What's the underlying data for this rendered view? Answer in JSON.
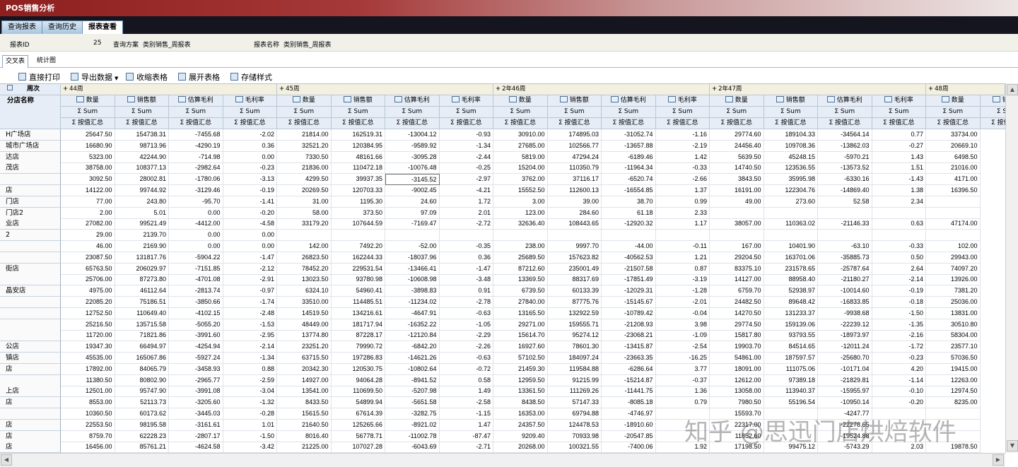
{
  "app": {
    "title": "POS销售分析"
  },
  "tabs": [
    "查询报表",
    "查询历史",
    "报表查看"
  ],
  "info": {
    "id_label": "报表ID",
    "id_value": "25",
    "plan_label": "查询方案",
    "plan_value": "类别销售_周报表",
    "name_label": "报表名称",
    "name_value": "类别销售_周报表"
  },
  "view_tabs": [
    "交叉表",
    "统计图"
  ],
  "toolbar": {
    "print": "直接打印",
    "export": "导出数据",
    "collapse": "收缩表格",
    "expand": "展开表格",
    "save_style": "存储样式"
  },
  "grid": {
    "week_label": "周次",
    "store_label": "分店名称",
    "weeks": [
      "44周",
      "45周",
      "2年46周",
      "2年47周",
      "48周"
    ],
    "measures": [
      "数量",
      "销售额",
      "估算毛利",
      "毛利率"
    ],
    "sum_label": "Sum",
    "agg_label": "按值汇总",
    "stores": [
      "H广场店",
      "城市广场店",
      "达店",
      "茂店",
      "",
      "店",
      "门店",
      "门店2",
      "业店",
      "2",
      "",
      "",
      "街店",
      "",
      "晶安店",
      "",
      "",
      "",
      "",
      "公店",
      "镇店",
      "店",
      "",
      "上店",
      "店",
      "",
      "店",
      "店",
      "店",
      ""
    ],
    "rows": [
      [
        "25647.50",
        "154738.31",
        "-7455.68",
        "-2.02",
        "21814.00",
        "162519.31",
        "-13004.12",
        "-0.93",
        "30910.00",
        "174895.03",
        "-31052.74",
        "-1.16",
        "29774.60",
        "189104.33",
        "-34564.14",
        "0.77",
        "33734.00"
      ],
      [
        "16680.90",
        "98713.96",
        "-4290.19",
        "0.36",
        "32521.20",
        "120384.95",
        "-9589.92",
        "-1.34",
        "27685.00",
        "102566.77",
        "-13657.88",
        "-2.19",
        "24456.40",
        "109708.36",
        "-13862.03",
        "-0.27",
        "20669.10"
      ],
      [
        "5323.00",
        "42244.90",
        "-714.98",
        "0.00",
        "7330.50",
        "48161.66",
        "-3095.28",
        "-2.44",
        "5819.00",
        "47294.24",
        "-6189.46",
        "1.42",
        "5639.50",
        "45248.15",
        "-5970.21",
        "1.43",
        "6498.50"
      ],
      [
        "38758.00",
        "108377.13",
        "-2982.64",
        "-0.23",
        "21836.00",
        "110472.18",
        "-10076.48",
        "-0.25",
        "15204.00",
        "110350.79",
        "-11964.34",
        "-0.33",
        "14740.50",
        "123536.55",
        "-13573.52",
        "1.51",
        "21016.00"
      ],
      [
        "3092.50",
        "28002.81",
        "-1780.06",
        "-3.13",
        "4299.50",
        "39937.35",
        "-3145.52",
        "-2.97",
        "3762.00",
        "37116.17",
        "-6520.74",
        "-2.66",
        "3843.50",
        "35995.98",
        "-6330.16",
        "-1.43",
        "4171.00"
      ],
      [
        "14122.00",
        "99744.92",
        "-3129.46",
        "-0.19",
        "20269.50",
        "120703.33",
        "-9002.45",
        "-4.21",
        "15552.50",
        "112600.13",
        "-16554.85",
        "1.37",
        "16191.00",
        "122304.76",
        "-14869.40",
        "1.38",
        "16396.50"
      ],
      [
        "77.00",
        "243.80",
        "-95.70",
        "-1.41",
        "31.00",
        "1195.30",
        "24.60",
        "1.72",
        "3.00",
        "39.00",
        "38.70",
        "0.99",
        "49.00",
        "273.60",
        "52.58",
        "2.34",
        ""
      ],
      [
        "2.00",
        "5.01",
        "0.00",
        "-0.20",
        "58.00",
        "373.50",
        "97.09",
        "2.01",
        "123.00",
        "284.60",
        "61.18",
        "2.33",
        "",
        "",
        "",
        "",
        ""
      ],
      [
        "27082.00",
        "99521.49",
        "-4412.00",
        "-4.58",
        "33179.20",
        "107644.59",
        "-7169.47",
        "-2.72",
        "32636.40",
        "108443.65",
        "-12920.32",
        "1.17",
        "38057.00",
        "110363.02",
        "-21146.33",
        "0.63",
        "47174.00"
      ],
      [
        "29.00",
        "2139.70",
        "0.00",
        "0.00",
        "",
        "",
        "",
        "",
        "",
        "",
        "",
        "",
        "",
        "",
        "",
        "",
        ""
      ],
      [
        "46.00",
        "2169.90",
        "0.00",
        "0.00",
        "142.00",
        "7492.20",
        "-52.00",
        "-0.35",
        "238.00",
        "9997.70",
        "-44.00",
        "-0.11",
        "167.00",
        "10401.90",
        "-63.10",
        "-0.33",
        "102.00"
      ],
      [
        "23087.50",
        "131817.76",
        "-5904.22",
        "-1.47",
        "26823.50",
        "162244.33",
        "-18037.96",
        "0.36",
        "25689.50",
        "157623.82",
        "-40562.53",
        "1.21",
        "29204.50",
        "163701.06",
        "-35885.73",
        "0.50",
        "29943.00"
      ],
      [
        "65763.50",
        "206029.97",
        "-7151.85",
        "-2.12",
        "78452.20",
        "229531.54",
        "-13466.41",
        "-1.47",
        "87212.60",
        "235001.49",
        "-21507.58",
        "0.87",
        "83375.10",
        "231578.65",
        "-25787.64",
        "2.64",
        "74097.20"
      ],
      [
        "25706.00",
        "87273.80",
        "-4701.08",
        "-2.91",
        "13023.50",
        "93780.98",
        "-10608.98",
        "-3.48",
        "13369.50",
        "88317.69",
        "-17851.49",
        "-3.19",
        "14127.00",
        "88958.40",
        "-21180.27",
        "-2.14",
        "13926.00"
      ],
      [
        "4975.00",
        "46112.64",
        "-2813.74",
        "-0.97",
        "6324.10",
        "54960.41",
        "-3898.83",
        "0.91",
        "6739.50",
        "60133.39",
        "-12029.31",
        "-1.28",
        "6759.70",
        "52938.97",
        "-10014.60",
        "-0.19",
        "7381.20"
      ],
      [
        "22085.20",
        "75186.51",
        "-3850.66",
        "-1.74",
        "33510.00",
        "114485.51",
        "-11234.02",
        "-2.78",
        "27840.00",
        "87775.76",
        "-15145.67",
        "-2.01",
        "24482.50",
        "89648.42",
        "-16833.85",
        "-0.18",
        "25036.00"
      ],
      [
        "12752.50",
        "110649.40",
        "-4102.15",
        "-2.48",
        "14519.50",
        "134216.61",
        "-4647.91",
        "-0.63",
        "13165.50",
        "132922.59",
        "-10789.42",
        "-0.04",
        "14270.50",
        "131233.37",
        "-9938.68",
        "-1.50",
        "13831.00"
      ],
      [
        "25216.50",
        "135715.58",
        "-5055.20",
        "-1.53",
        "48449.00",
        "181717.94",
        "-16352.22",
        "-1.05",
        "29271.00",
        "159555.71",
        "-21208.93",
        "3.98",
        "29774.50",
        "159139.06",
        "-22239.12",
        "-1.35",
        "30510.80"
      ],
      [
        "11720.00",
        "71821.86",
        "-3991.60",
        "-2.95",
        "13774.80",
        "87228.17",
        "-12120.84",
        "-2.29",
        "15614.70",
        "95274.12",
        "-23068.21",
        "-1.09",
        "15817.80",
        "93793.55",
        "-18973.97",
        "-2.16",
        "58304.00"
      ],
      [
        "19347.30",
        "66494.97",
        "-4254.94",
        "-2.14",
        "23251.20",
        "79990.72",
        "-6842.20",
        "-2.26",
        "16927.60",
        "78601.30",
        "-13415.87",
        "-2.54",
        "19903.70",
        "84514.65",
        "-12011.24",
        "-1.72",
        "23577.10"
      ],
      [
        "45535.00",
        "165067.86",
        "-5927.24",
        "-1.34",
        "63715.50",
        "197286.83",
        "-14621.26",
        "-0.63",
        "57102.50",
        "184097.24",
        "-23663.35",
        "-16.25",
        "54861.00",
        "187597.57",
        "-25680.70",
        "-0.23",
        "57036.50"
      ],
      [
        "17892.00",
        "84065.79",
        "-3458.93",
        "0.88",
        "20342.30",
        "120530.75",
        "-10802.64",
        "-0.72",
        "21459.30",
        "119584.88",
        "-6286.64",
        "3.77",
        "18091.00",
        "111075.06",
        "-10171.04",
        "4.20",
        "19415.00"
      ],
      [
        "11380.50",
        "80802.90",
        "-2965.77",
        "-2.59",
        "14927.00",
        "94064.28",
        "-8941.52",
        "0.58",
        "12959.50",
        "91215.99",
        "-15214.87",
        "-0.37",
        "12612.00",
        "97389.18",
        "-21829.81",
        "-1.14",
        "12263.00"
      ],
      [
        "12501.00",
        "95747.90",
        "-3991.08",
        "-3.04",
        "13541.00",
        "110699.50",
        "-5207.98",
        "1.49",
        "13361.50",
        "111269.26",
        "-11441.75",
        "1.36",
        "13058.00",
        "113940.37",
        "-15955.97",
        "-0.10",
        "12974.50"
      ],
      [
        "8553.00",
        "52113.73",
        "-3205.60",
        "-1.32",
        "8433.50",
        "54899.94",
        "-5651.58",
        "-2.58",
        "8438.50",
        "57147.33",
        "-8085.18",
        "0.79",
        "7980.50",
        "55196.54",
        "-10950.14",
        "-0.20",
        "8235.00"
      ],
      [
        "10360.50",
        "60173.62",
        "-3445.03",
        "-0.28",
        "15615.50",
        "67614.39",
        "-3282.75",
        "-1.15",
        "16353.00",
        "69794.88",
        "-4746.97",
        "",
        "15593.70",
        "",
        "-4247.77",
        "",
        ""
      ],
      [
        "22553.50",
        "98195.58",
        "-3161.61",
        "1.01",
        "21640.50",
        "125265.66",
        "-8921.02",
        "1.47",
        "24357.50",
        "124478.53",
        "-18910.60",
        "",
        "22317.00",
        "",
        "-22278.65",
        "",
        ""
      ],
      [
        "8759.70",
        "62228.23",
        "-2807.17",
        "-1.50",
        "8016.40",
        "56778.71",
        "-11002.78",
        "-87.47",
        "9209.40",
        "70933.98",
        "-20547.85",
        "",
        "11852.60",
        "",
        "-19524.88",
        "",
        ""
      ],
      [
        "16456.00",
        "85761.21",
        "-4624.58",
        "-3.42",
        "21225.00",
        "107027.28",
        "-6043.69",
        "-2.71",
        "20268.00",
        "100321.55",
        "-7400.06",
        "1.92",
        "17198.50",
        "99475.12",
        "-5743.29",
        "2.03",
        "19878.50"
      ]
    ]
  },
  "watermark": "知乎 @思迅门店烘焙软件"
}
